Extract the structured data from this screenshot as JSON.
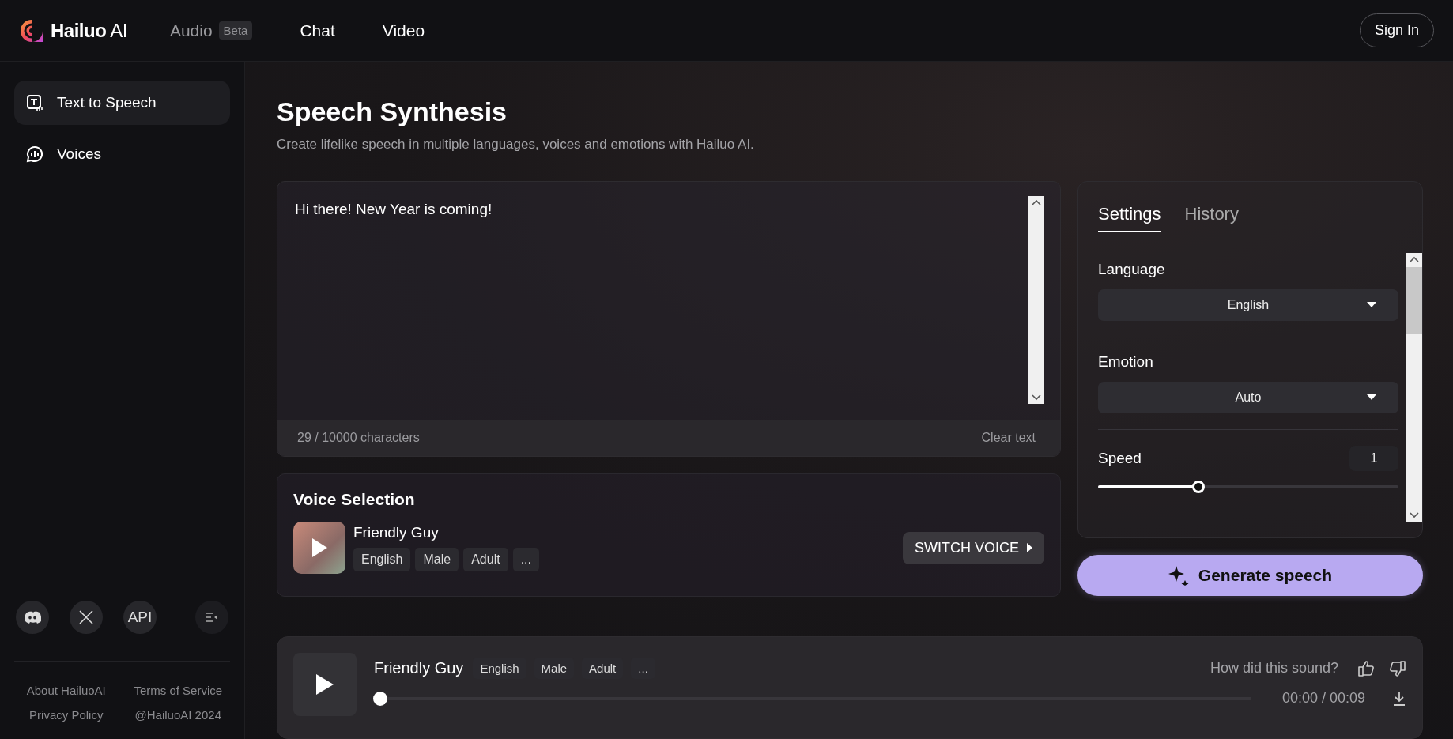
{
  "header": {
    "logo": "**Hailuo** AI",
    "nav": [
      {
        "label": "Audio",
        "badge": "Beta",
        "selected": true
      },
      {
        "label": "Chat",
        "selected": false
      },
      {
        "label": "Video",
        "selected": false
      }
    ],
    "sign_in": "Sign In"
  },
  "sidebar": {
    "items": [
      {
        "label": "Text to Speech",
        "kind": "text",
        "selected": true
      },
      {
        "label": "Voices",
        "kind": "voice",
        "selected": false
      }
    ],
    "social": [
      {
        "kind": "discord"
      },
      {
        "kind": "x"
      },
      {
        "kind": "text",
        "label": "API"
      },
      {
        "kind": "collapse"
      }
    ],
    "footer_links": [
      "About HailuoAI",
      "Terms of Service",
      "Privacy Policy",
      "@HailuoAI 2024"
    ]
  },
  "main": {
    "title": "Speech Synthesis",
    "subtitle": "Create lifelike speech in multiple languages, voices and emotions with Hailuo AI.",
    "editor": {
      "value": "Hi there! New Year is coming!",
      "counter": "29 / 10000 characters",
      "clear": "Clear text"
    },
    "voice_selection": {
      "title": "Voice Selection",
      "voice": "Friendly Guy",
      "tags": [
        "English",
        "Male",
        "Adult",
        "..."
      ],
      "switch": "SWITCH VOICE"
    }
  },
  "settings": {
    "tabs": [
      {
        "label": "Settings",
        "selected": true
      },
      {
        "label": "History",
        "selected": false
      }
    ],
    "fields": [
      {
        "kind": "select",
        "label": "Language",
        "value": "English"
      },
      {
        "kind": "select",
        "label": "Emotion",
        "value": "Auto"
      },
      {
        "kind": "slider",
        "label": "Speed",
        "value": "1",
        "level": 0.335
      }
    ],
    "generate": "Generate speech"
  },
  "player": {
    "voice": "Friendly Guy",
    "tags": [
      "English",
      "Male",
      "Adult",
      "..."
    ],
    "prompt": "How did this sound?",
    "time": "00:00 / 00:09",
    "level": 0
  }
}
